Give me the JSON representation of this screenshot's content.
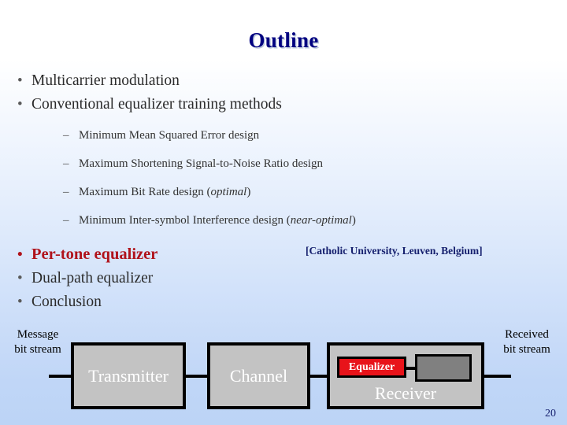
{
  "slide": {
    "title": "Outline",
    "number": "20",
    "accent_red": "#b0131b",
    "accent_navy": "#000080",
    "equalizer_red": "#e8131a",
    "box_gray": "#c3c3c3",
    "inner_gray": "#808080"
  },
  "outline": {
    "items": [
      {
        "level": 1,
        "bullet": "•",
        "text": "Multicarrier modulation",
        "emphasis": false
      },
      {
        "level": 1,
        "bullet": "•",
        "text": "Conventional equalizer training methods",
        "emphasis": false
      },
      {
        "level": 2,
        "bullet": "–",
        "text": "Minimum Mean Squared Error design",
        "italic_suffix": ""
      },
      {
        "level": 2,
        "bullet": "–",
        "text": "Maximum Shortening Signal-to-Noise Ratio design",
        "italic_suffix": ""
      },
      {
        "level": 2,
        "bullet": "–",
        "text_prefix": "Maximum Bit Rate design (",
        "italic": "optimal",
        "text_suffix": ")"
      },
      {
        "level": 2,
        "bullet": "–",
        "text_prefix": "Minimum Inter-symbol Interference design (",
        "italic": "near-optimal",
        "text_suffix": ")"
      },
      {
        "level": 1,
        "bullet": "•",
        "text": "Per-tone equalizer",
        "emphasis": true
      },
      {
        "level": 1,
        "bullet": "•",
        "text": "Dual-path equalizer",
        "emphasis": false
      },
      {
        "level": 1,
        "bullet": "•",
        "text": "Conclusion",
        "emphasis": false
      }
    ],
    "attribution": "[Catholic University, Leuven, Belgium]"
  },
  "diagram": {
    "input_label_line1": "Message",
    "input_label_line2": "bit stream",
    "output_label_line1": "Received",
    "output_label_line2": "bit stream",
    "transmitter": "Transmitter",
    "channel": "Channel",
    "receiver": "Receiver",
    "equalizer": "Equalizer"
  }
}
